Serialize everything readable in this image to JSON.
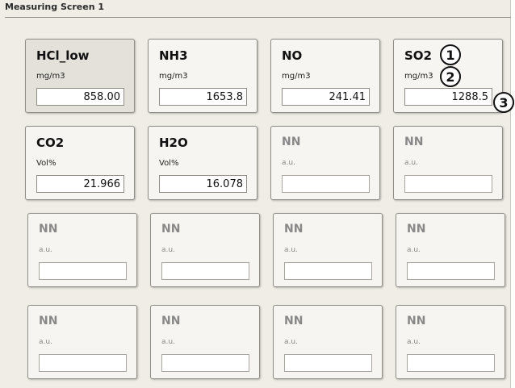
{
  "panel": {
    "title": "Measuring Screen 1"
  },
  "tiles": [
    {
      "name": "HCl_low",
      "unit": "mg/m3",
      "value": "858.00"
    },
    {
      "name": "NH3",
      "unit": "mg/m3",
      "value": "1653.8"
    },
    {
      "name": "NO",
      "unit": "mg/m3",
      "value": "241.41"
    },
    {
      "name": "SO2",
      "unit": "mg/m3",
      "value": "1288.5"
    },
    {
      "name": "CO2",
      "unit": "Vol%",
      "value": "21.966"
    },
    {
      "name": "H2O",
      "unit": "Vol%",
      "value": "16.078"
    },
    {
      "name": "NN",
      "unit": "a.u.",
      "value": ""
    },
    {
      "name": "NN",
      "unit": "a.u.",
      "value": ""
    },
    {
      "name": "NN",
      "unit": "a.u.",
      "value": ""
    },
    {
      "name": "NN",
      "unit": "a.u.",
      "value": ""
    },
    {
      "name": "NN",
      "unit": "a.u.",
      "value": ""
    },
    {
      "name": "NN",
      "unit": "a.u.",
      "value": ""
    },
    {
      "name": "NN",
      "unit": "a.u.",
      "value": ""
    },
    {
      "name": "NN",
      "unit": "a.u.",
      "value": ""
    },
    {
      "name": "NN",
      "unit": "a.u.",
      "value": ""
    },
    {
      "name": "NN",
      "unit": "a.u.",
      "value": ""
    }
  ],
  "callouts": [
    "1",
    "2",
    "3"
  ]
}
